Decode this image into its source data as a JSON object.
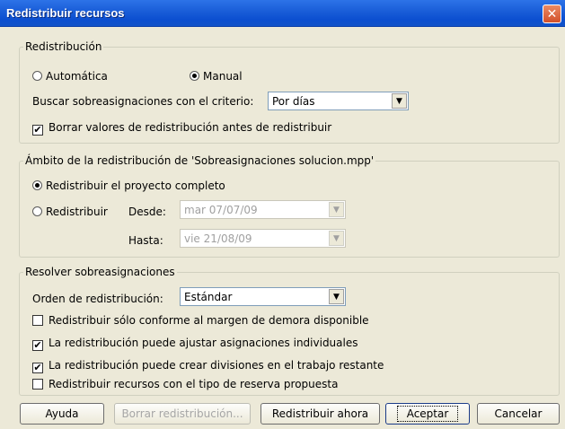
{
  "window": {
    "title": "Redistribuir recursos",
    "close_label": "✕"
  },
  "redistribucion": {
    "legend": "Redistribución",
    "automatica_label": "Automática",
    "automatica_selected": false,
    "manual_label": "Manual",
    "manual_selected": true,
    "buscar_label": "Buscar sobreasignaciones con el criterio:",
    "buscar_value": "Por días",
    "borrar_label": "Borrar valores de redistribución antes de redistribuir",
    "borrar_checked": true
  },
  "ambito": {
    "legend": "Ámbito de la redistribución de 'Sobreasignaciones solucion.mpp'",
    "completo_label": "Redistribuir el proyecto completo",
    "completo_selected": true,
    "redistribuir_label": "Redistribuir",
    "desde_label": "Desde:",
    "desde_value": "mar 07/07/09",
    "hasta_label": "Hasta:",
    "hasta_value": "vie 21/08/09"
  },
  "resolver": {
    "legend": "Resolver sobreasignaciones",
    "orden_label": "Orden de redistribución:",
    "orden_value": "Estándar",
    "options": [
      {
        "label": "Redistribuir sólo conforme al margen de demora disponible",
        "checked": false
      },
      {
        "label": "La redistribución puede ajustar asignaciones individuales",
        "checked": true
      },
      {
        "label": "La redistribución puede crear divisiones en el trabajo restante",
        "checked": true
      },
      {
        "label": "Redistribuir recursos con el tipo de reserva propuesta",
        "checked": false
      }
    ]
  },
  "buttons": {
    "ayuda": "Ayuda",
    "borrar": "Borrar redistribución...",
    "redistribuir": "Redistribuir ahora",
    "aceptar": "Aceptar",
    "cancelar": "Cancelar"
  },
  "icons": {
    "check": "✔",
    "dropdown": "▼"
  }
}
